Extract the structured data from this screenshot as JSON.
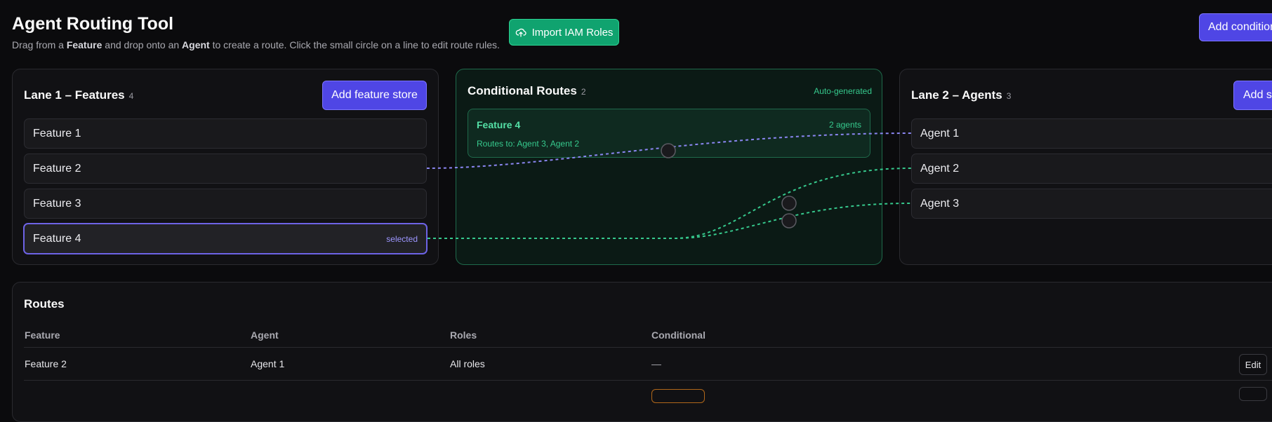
{
  "header": {
    "title": "Agent Routing Tool",
    "subtitle_parts": [
      "Drag from a ",
      "Feature",
      " and drop onto an ",
      "Agent",
      " to create a route. Click the small circle on a line to edit route rules."
    ],
    "import_label": "Import IAM Roles",
    "add_condition_label": "Add condition"
  },
  "lane1": {
    "title": "Lane 1 – Features",
    "count": "4",
    "add_label": "Add feature store",
    "items": [
      "Feature 1",
      "Feature 2",
      "Feature 3",
      "Feature 4"
    ],
    "selected_tag": "selected"
  },
  "conditional": {
    "title": "Conditional Routes",
    "count": "2",
    "badge": "Auto-generated",
    "card": {
      "feature": "Feature 4",
      "agents_count": "2 agents",
      "routes_to": "Routes to: Agent 3, Agent 2"
    }
  },
  "lane2": {
    "title": "Lane 2 – Agents",
    "count": "3",
    "add_label": "Add store",
    "items": [
      "Agent 1",
      "Agent 2",
      "Agent 3"
    ]
  },
  "routes": {
    "title": "Routes",
    "columns": [
      "Feature",
      "Agent",
      "Roles",
      "Conditional"
    ],
    "rows": [
      {
        "feature": "Feature 2",
        "agent": "Agent 1",
        "roles": "All roles",
        "conditional": "—",
        "action": "Edit"
      }
    ]
  },
  "colors": {
    "indigo": "#4f46e5",
    "green": "#10a36f",
    "route_blue": "#8b86f2",
    "route_green": "#36c98d"
  }
}
